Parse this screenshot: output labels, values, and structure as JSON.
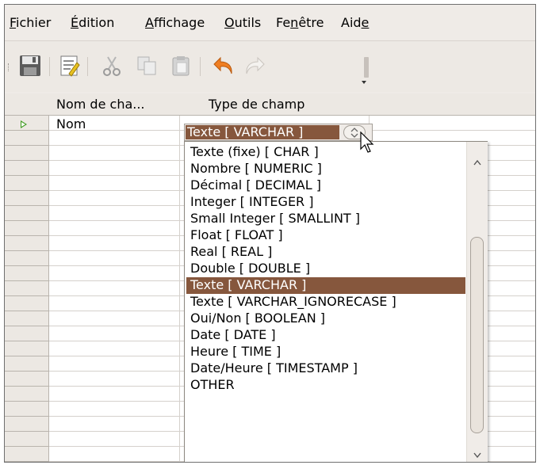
{
  "menubar": {
    "items": [
      {
        "label": "Fichier"
      },
      {
        "label": "Édition"
      },
      {
        "label": "Affichage"
      },
      {
        "label": "Outils"
      },
      {
        "label": "Fenêtre"
      },
      {
        "label": "Aide"
      }
    ]
  },
  "toolbar": {
    "buttons": [
      "save-icon",
      "edit-document-icon",
      "cut-icon",
      "copy-icon",
      "paste-icon",
      "undo-icon",
      "redo-icon"
    ]
  },
  "grid": {
    "columns": [
      "Nom de cha...",
      "Type de champ"
    ],
    "rows": [
      {
        "name": "Nom",
        "type": "Texte [ VARCHAR ]"
      }
    ]
  },
  "dropdown": {
    "selected_index": 9,
    "options": [
      "Texte (fixe) [ CHAR ]",
      "Nombre [ NUMERIC ]",
      "Décimal [ DECIMAL ]",
      "Integer [ INTEGER ]",
      "Small Integer [ SMALLINT ]",
      "Float [ FLOAT ]",
      "Real [ REAL ]",
      "Double [ DOUBLE ]",
      "Texte [ VARCHAR ]",
      "Texte [ VARCHAR ]",
      "Texte [ VARCHAR_IGNORECASE ]",
      "Oui/Non [ BOOLEAN ]",
      "Date [ DATE ]",
      "Heure [ TIME ]",
      "Date/Heure [ TIMESTAMP ]",
      "OTHER"
    ]
  },
  "colors": {
    "selection": "#86573d",
    "current_row_marker": "#3d9a1f",
    "undo_orange": "#ef7e22"
  }
}
